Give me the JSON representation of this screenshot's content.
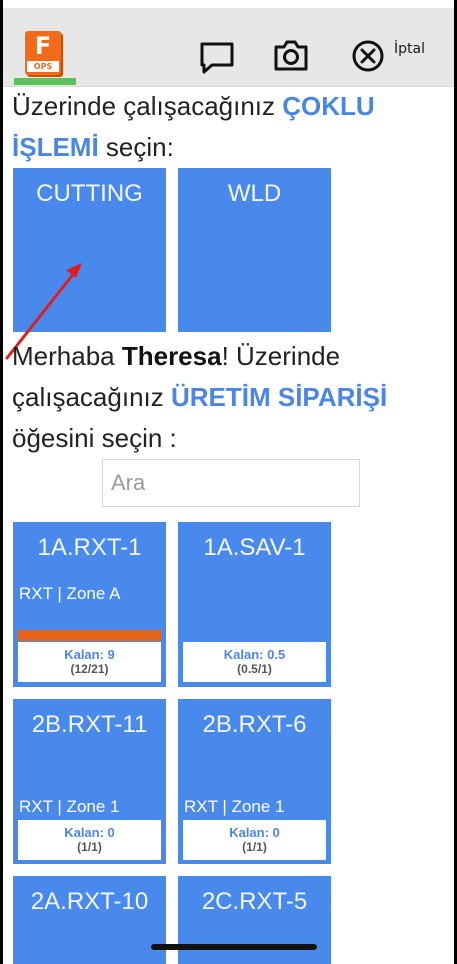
{
  "header": {
    "app_icon_letter": "F",
    "app_icon_caption": "OPS",
    "cancel_label": "İptal",
    "icons": [
      "chat-icon",
      "camera-icon",
      "close-circle-icon"
    ]
  },
  "operation_prompt": {
    "prefix": "Üzerinde çalışacağınız ",
    "highlight": "ÇOKLU İŞLEMİ",
    "suffix": " seçin:"
  },
  "operations": [
    {
      "label": "CUTTING"
    },
    {
      "label": "WLD"
    }
  ],
  "order_prompt": {
    "greeting": "Merhaba ",
    "user": "Theresa",
    "middle": "! Üzerinde çalışacağınız ",
    "highlight": "ÜRETİM SİPARİŞİ",
    "suffix": " öğesini seçin :"
  },
  "search": {
    "placeholder": "Ara",
    "value": ""
  },
  "orders": [
    {
      "name": "1A.RXT-1",
      "location": "RXT | Zone A",
      "remaining": "Kalan: 9",
      "ratio": "(12/21)",
      "progress": 1.0
    },
    {
      "name": "1A.SAV-1",
      "location": "",
      "remaining": "Kalan: 0.5",
      "ratio": "(0.5/1)",
      "progress": 0
    },
    {
      "name": "2B.RXT-11",
      "location": "RXT | Zone 1",
      "remaining": "Kalan: 0",
      "ratio": "(1/1)",
      "progress": 0
    },
    {
      "name": "2B.RXT-6",
      "location": "RXT | Zone 1",
      "remaining": "Kalan: 0",
      "ratio": "(1/1)",
      "progress": 0
    },
    {
      "name": "2A.RXT-10",
      "location": "",
      "remaining": "",
      "ratio": "",
      "progress": 0
    },
    {
      "name": "2C.RXT-5",
      "location": "",
      "remaining": "",
      "ratio": "",
      "progress": 0
    }
  ],
  "colors": {
    "accent": "#4a86e8",
    "tile": "#4a89ec",
    "progress": "#e4661d",
    "brand": "#f26a1b"
  }
}
